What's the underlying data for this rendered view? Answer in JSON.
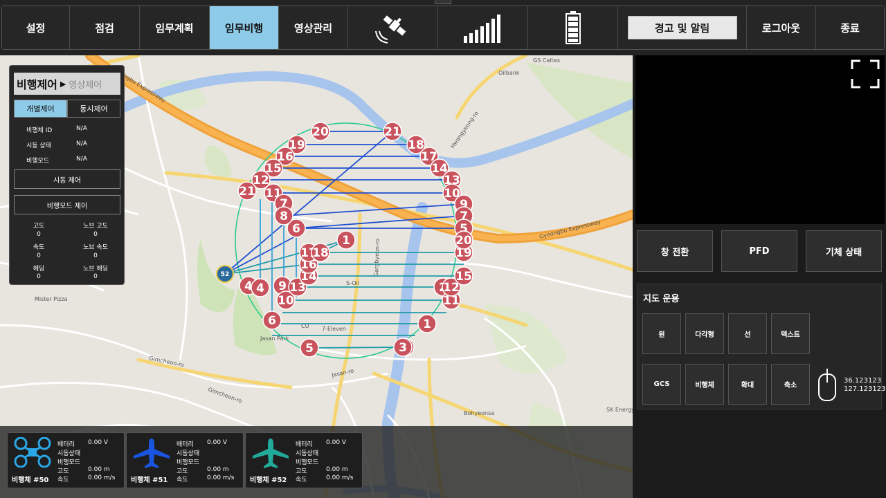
{
  "topbar": {
    "menu": [
      {
        "label": "설정"
      },
      {
        "label": "점검"
      },
      {
        "label": "임무계획"
      },
      {
        "label": "임무비행"
      },
      {
        "label": "영상관리"
      }
    ],
    "status_icons": [
      "satellite-icon",
      "signal-strength-icon",
      "battery-icon"
    ],
    "alert_label": "경고 및 알림",
    "logout_label": "로그아웃",
    "exit_label": "종료",
    "active_color": "#8ecbe8"
  },
  "flight_control": {
    "title": "비행제어",
    "alt_title": "영상제어",
    "tab_individual": "개별제어",
    "tab_simultaneous": "동시제어",
    "rows": [
      {
        "label": "비행체 ID",
        "value": "N/A"
      },
      {
        "label": "시동 상태",
        "value": "N/A"
      },
      {
        "label": "비행모드",
        "value": "N/A"
      }
    ],
    "start_button": "시동 제어",
    "mode_button": "비행모드 제어",
    "telemetry": [
      {
        "label": "고도",
        "value": "0"
      },
      {
        "label": "노브 고도",
        "value": "0"
      },
      {
        "label": "속도",
        "value": "0"
      },
      {
        "label": "노브 속도",
        "value": "0"
      },
      {
        "label": "헤딩",
        "value": "0"
      },
      {
        "label": "노브 헤딩",
        "value": "0"
      }
    ]
  },
  "map": {
    "drone_marker_label": "52",
    "labels": {
      "expressway_nw": "Gyeongbu Expressway",
      "expressway_se": "Gyeongbu Expressway",
      "hwangyeong": "Hwangyeong-ro",
      "gimcheon": "Gimcheon-ro",
      "gimcheon2": "Gimcheon-ro",
      "jasan": "Jasan-ro",
      "gargbyeon": "Gargbyeon-ro",
      "oilbank": "Oilbank",
      "gscaltex": "GS Caltex",
      "bohyeonsa": "Bohyeonsa",
      "skenergy": "SK Energy",
      "mister_pizza": "Mister Pizza",
      "seven_eleven": "7-Eleven",
      "cu": "CU",
      "jasan_park": "Jasan Park",
      "soil": "S-Oil"
    },
    "waypoints_outer": [
      "20",
      "21",
      "19",
      "18",
      "16",
      "17",
      "15",
      "14",
      "12",
      "13",
      "11",
      "10",
      "9",
      "8",
      "7",
      "6",
      "5",
      "4",
      "3",
      "2",
      "1"
    ],
    "waypoints_inner": [
      "1",
      "2",
      "3",
      "4",
      "5",
      "6",
      "7",
      "8",
      "9",
      "10",
      "11",
      "12",
      "13",
      "14",
      "15",
      "16",
      "17",
      "18",
      "19",
      "20",
      "21"
    ]
  },
  "video_panel": {
    "fullscreen_icon": "fullscreen-icon"
  },
  "panel_buttons": {
    "switch_window": "창 전환",
    "pfd": "PFD",
    "vehicle_status": "기체 상태"
  },
  "map_ops": {
    "title": "지도 운용",
    "row1": [
      "원",
      "다각형",
      "선",
      "텍스트"
    ],
    "row2": [
      "GCS",
      "비행체",
      "확대",
      "축소"
    ],
    "lat": "36.123123",
    "lon": "127.123123"
  },
  "vehicles": [
    {
      "name": "비행체 #50",
      "icon": "quadcopter-icon",
      "color": "#2aa7e6",
      "battery": "0.00 V",
      "alt": "0.00 m",
      "speed": "0.00 m/s"
    },
    {
      "name": "비행체 #51",
      "icon": "airplane-icon",
      "color": "#1a55e0",
      "battery": "0.00 V",
      "alt": "0.00 m",
      "speed": "0.00 m/s"
    },
    {
      "name": "비행체 #52",
      "icon": "airplane-icon",
      "color": "#22a99a",
      "battery": "0.00 V",
      "alt": "0.00 m",
      "speed": "0.00 m/s"
    }
  ],
  "vehicle_labels": {
    "battery": "배터리",
    "start": "시동상태",
    "mode": "비행모드",
    "alt": "고도",
    "speed": "속도"
  }
}
